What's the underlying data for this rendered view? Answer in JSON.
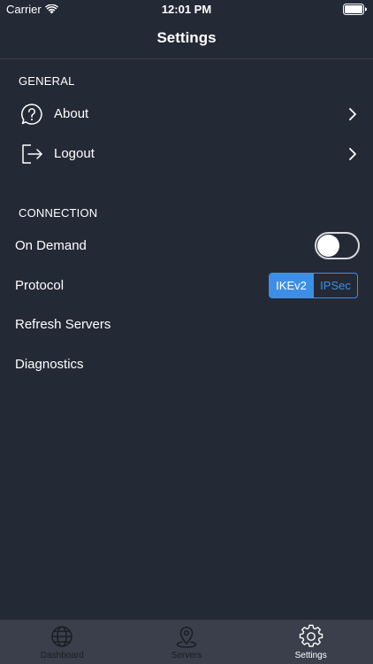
{
  "status_bar": {
    "carrier": "Carrier",
    "time": "12:01 PM"
  },
  "nav": {
    "title": "Settings"
  },
  "general": {
    "header": "GENERAL",
    "items": [
      {
        "label": "About",
        "icon": "question-bubble-icon"
      },
      {
        "label": "Logout",
        "icon": "logout-icon"
      }
    ]
  },
  "connection": {
    "header": "CONNECTION",
    "on_demand": {
      "label": "On Demand",
      "enabled": false
    },
    "protocol": {
      "label": "Protocol",
      "options": [
        "IKEv2",
        "IPSec"
      ],
      "selected": "IKEv2"
    },
    "refresh_label": "Refresh Servers",
    "diagnostics_label": "Diagnostics"
  },
  "tab_bar": {
    "tabs": [
      {
        "label": "Dashboard",
        "icon": "globe-icon",
        "active": false
      },
      {
        "label": "Servers",
        "icon": "location-pin-icon",
        "active": false
      },
      {
        "label": "Settings",
        "icon": "gear-icon",
        "active": true
      }
    ]
  },
  "colors": {
    "background": "#242936",
    "accent": "#3d8fe6",
    "tab_bar": "#3a3f4b"
  }
}
